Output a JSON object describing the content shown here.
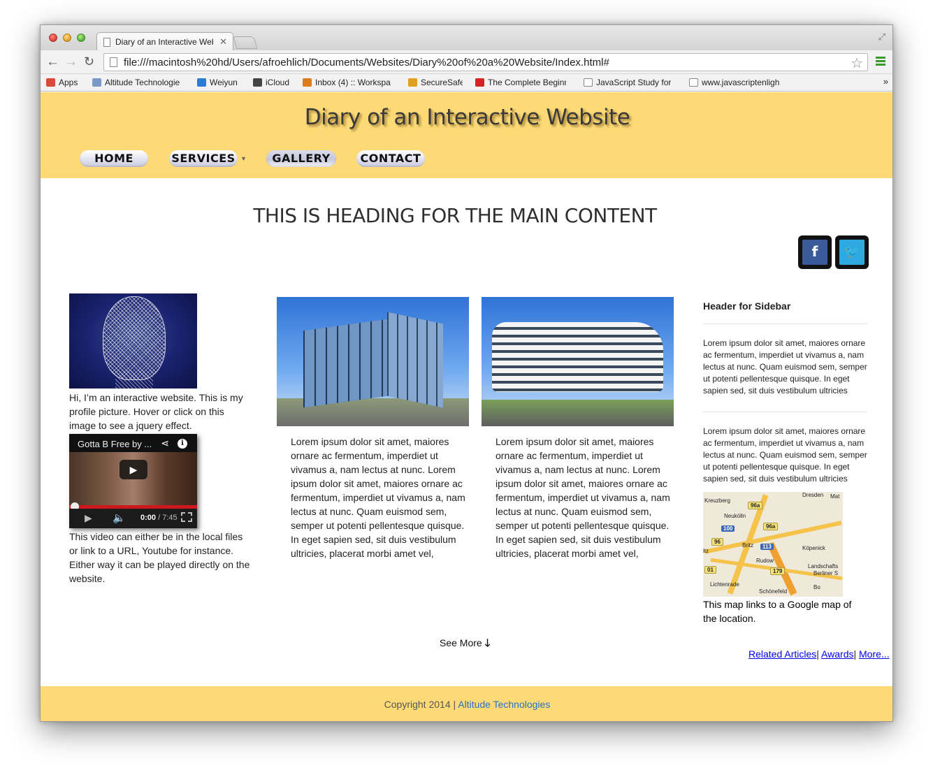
{
  "browser": {
    "tab_title": "Diary of an Interactive Web",
    "tab_close": "✕",
    "url": "file:///macintosh%20hd/Users/afroehlich/Documents/Websites/Diary%20of%20a%20Website/Index.html#",
    "bookmarks": [
      {
        "label": "Apps",
        "icon": "apps-grid-icon",
        "color": "#d94a3a"
      },
      {
        "label": "Altitude Technologie",
        "icon": "folder-icon",
        "color": "#7a98c8"
      },
      {
        "label": "Weiyun",
        "icon": "cloud-icon",
        "color": "#2e7ad8"
      },
      {
        "label": "iCloud",
        "icon": "apple-icon",
        "color": "#444444"
      },
      {
        "label": "Inbox (4) :: Workspa",
        "icon": "mail-icon",
        "color": "#e07a1a"
      },
      {
        "label": "SecureSafe",
        "icon": "shield-icon",
        "color": "#e0a020"
      },
      {
        "label": "The Complete Beginn",
        "icon": "youtube-icon",
        "color": "#d62222"
      },
      {
        "label": "JavaScript Study for",
        "icon": "page-icon",
        "color": "#ffffff"
      },
      {
        "label": "www.javascriptenligh",
        "icon": "page-icon",
        "color": "#ffffff"
      }
    ],
    "bookmarks_more": "»"
  },
  "site": {
    "title": "Diary of an Interactive Website",
    "nav": [
      "HOME",
      "SERVICES",
      "GALLERY",
      "CONTACT"
    ],
    "main_heading": "THIS IS HEADING FOR THE MAIN CONTENT",
    "social": {
      "facebook": "f",
      "twitter": "t"
    },
    "profile_text": "Hi, I’m an interactive website. This is my profile picture. Hover or click on this image to see a jquery effect.",
    "video": {
      "title": "Gotta B Free by ...",
      "current_time": "0:00",
      "duration": "/ 7:45",
      "progress": 0
    },
    "video_text": "This video can either be in the local files or link to a URL, Youtube for instance. Either way it can be played directly on the website.",
    "cards": [
      {
        "text": "Lorem ipsum dolor sit amet, maiores ornare ac fermentum, imperdiet ut vivamus a, nam lectus at nunc. Lorem ipsum dolor sit amet, maiores ornare ac fermentum, imperdiet ut vivamus a, nam lectus at nunc. Quam euismod sem, semper ut potenti pellentesque quisque. In eget sapien sed, sit duis vestibulum ultricies, placerat morbi amet vel,"
      },
      {
        "text": "Lorem ipsum dolor sit amet, maiores ornare ac fermentum, imperdiet ut vivamus a, nam lectus at nunc. Lorem ipsum dolor sit amet, maiores ornare ac fermentum, imperdiet ut vivamus a, nam lectus at nunc. Quam euismod sem, semper ut potenti pellentesque quisque. In eget sapien sed, sit duis vestibulum ultricies, placerat morbi amet vel,"
      }
    ],
    "sidebar": {
      "heading": "Header for Sidebar",
      "paragraph1": "Lorem ipsum dolor sit amet, maiores ornare ac fermentum, imperdiet ut vivamus a, nam lectus at nunc. Quam euismod sem, semper ut potenti pellentesque quisque. In eget sapien sed, sit duis vestibulum ultricies",
      "paragraph2": "Lorem ipsum dolor sit amet, maiores ornare ac fermentum, imperdiet ut vivamus a, nam lectus at nunc. Quam euismod sem, semper ut potenti pellentesque quisque. In eget sapien sed, sit duis vestibulum ultricies",
      "map_labels": [
        "Kreuzberg",
        "Neukölln",
        "Britz",
        "Rudow",
        "Köpenick",
        "Landschafts",
        "Berliner S",
        "Lichtenrade",
        "Schönefeld",
        "itz",
        "Bo",
        "Mat",
        "Dresden"
      ],
      "map_shields": [
        "96a",
        "100",
        "96a",
        "96",
        "113",
        "01",
        "179"
      ],
      "map_caption": "This map links to a Google map of the location."
    },
    "see_more": "See More",
    "links": [
      "Related Articles",
      "Awards",
      "More..."
    ],
    "footer_text": "Copyright 2014 | ",
    "footer_link": "Altitude Technologies"
  }
}
